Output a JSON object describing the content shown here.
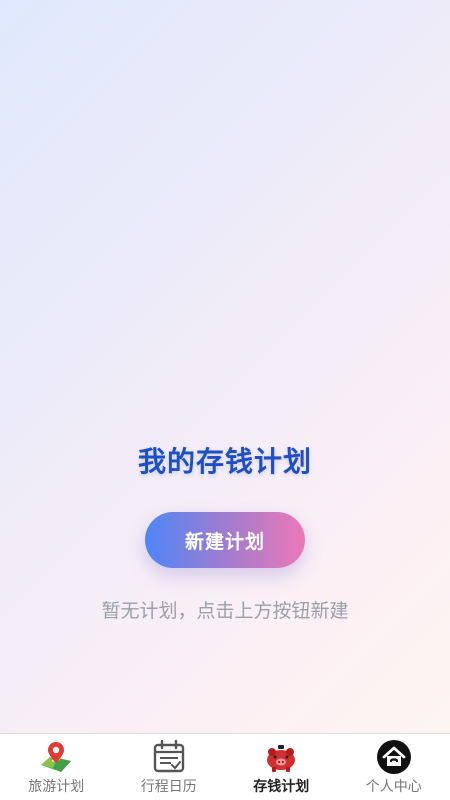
{
  "main": {
    "title": "我的存钱计划",
    "new_plan_button": "新建计划",
    "empty_hint": "暂无计划，点击上方按钮新建"
  },
  "tabbar": {
    "active_index": 2,
    "items": [
      {
        "label": "旅游计划",
        "icon": "map-pin-icon"
      },
      {
        "label": "行程日历",
        "icon": "calendar-icon"
      },
      {
        "label": "存钱计划",
        "icon": "piggy-bank-icon"
      },
      {
        "label": "个人中心",
        "icon": "home-icon"
      }
    ]
  },
  "colors": {
    "title": "#1f4fc4",
    "button_gradient_start": "#4e86f6",
    "button_gradient_end": "#ec78b7",
    "hint": "#9aa0ab",
    "tab_active": "#222222",
    "tab_inactive": "#777777"
  }
}
